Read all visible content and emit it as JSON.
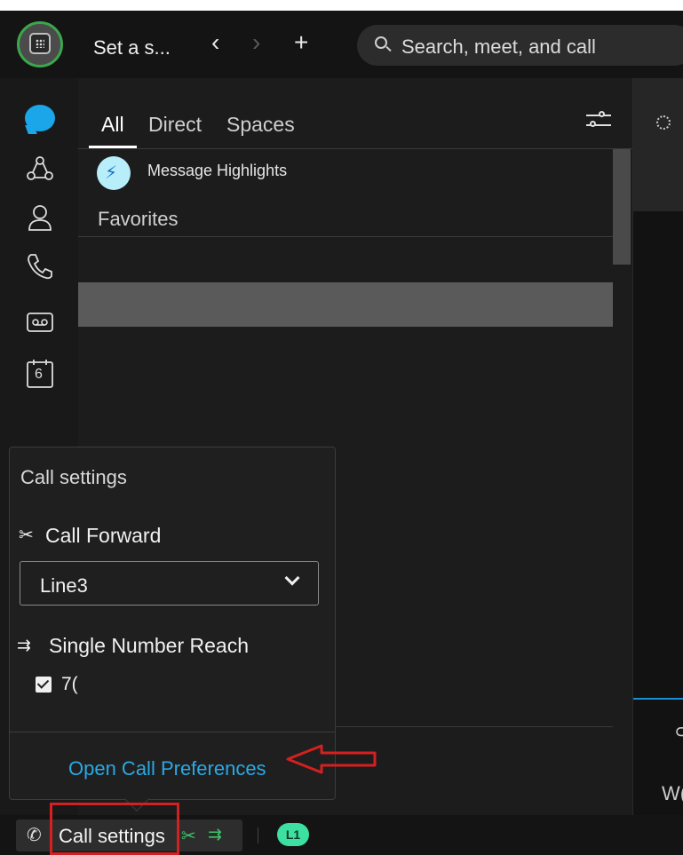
{
  "header": {
    "status_text": "Set a s...",
    "back_icon": "‹",
    "forward_icon": "›",
    "add_icon": "+",
    "search_placeholder": "Search, meet, and call"
  },
  "rail": {
    "items": [
      {
        "icon": "message-icon",
        "active": true
      },
      {
        "icon": "teams-icon"
      },
      {
        "icon": "contacts-icon"
      },
      {
        "icon": "calling-icon"
      },
      {
        "icon": "voicemail-icon"
      },
      {
        "icon": "calendar-icon",
        "day": "6"
      }
    ]
  },
  "list": {
    "tabs": [
      "All",
      "Direct",
      "Spaces"
    ],
    "active_tab": "All",
    "highlights_label": "Message Highlights",
    "favorites_label": "Favorites"
  },
  "popup": {
    "title": "Call settings",
    "call_forward_label": "Call Forward",
    "line_value": "Line3",
    "single_number_reach_label": "Single Number Reach",
    "snr_checked": true,
    "snr_number": "7(",
    "open_prefs_label": "Open Call Preferences"
  },
  "right_pane": {
    "partial_text": "W("
  },
  "statusbar": {
    "call_settings_label": "Call settings",
    "line_badge": "L1"
  },
  "colors": {
    "accent_blue": "#29a9e6",
    "status_green": "#3cc36a",
    "annotation_red": "#d32020",
    "line_badge": "#3de0a0"
  }
}
